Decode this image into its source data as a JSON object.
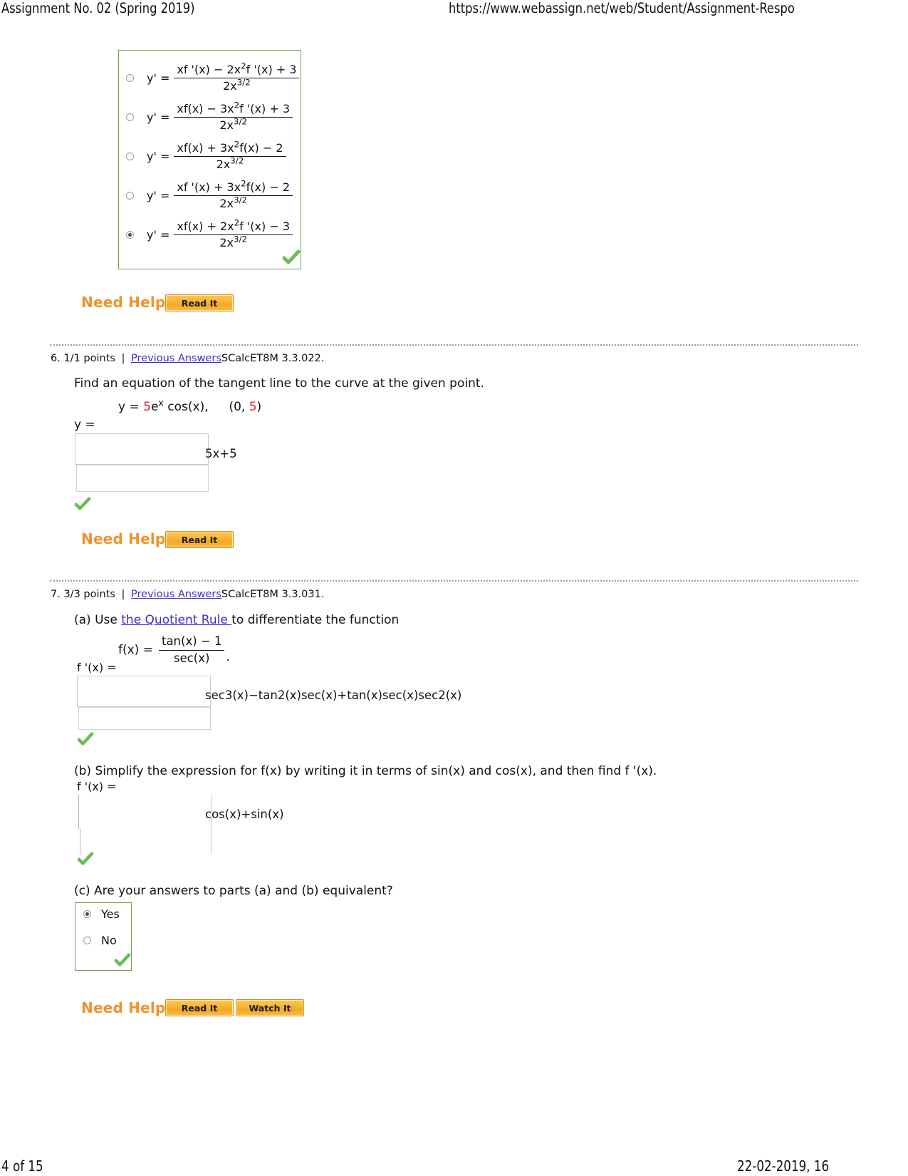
{
  "page": {
    "header_left": "Assignment No. 02 (Spring 2019)",
    "header_right": "https://www.webassign.net/web/Student/Assignment-Respo",
    "footer_left": "4 of 15",
    "footer_right": "22-02-2019, 16"
  },
  "question5": {
    "choices": [
      {
        "lhs": "y' =",
        "numerator": "xf '(x) − 2x 2f '(x) + 3",
        "denominator": "2x3/2",
        "selected": false
      },
      {
        "lhs": "y' =",
        "numerator": "xf(x) − 3x 2f '(x) + 3",
        "denominator": "2x3/2",
        "selected": false
      },
      {
        "lhs": "y' =",
        "numerator": "xf(x) + 3x 2f(x) − 2",
        "denominator": "2x3/2",
        "selected": false
      },
      {
        "lhs": "y' =",
        "numerator": "xf '(x) + 3x 2f(x) − 2",
        "denominator": "2x3/2",
        "selected": false
      },
      {
        "lhs": "y' =",
        "numerator": "xf(x) + 2x 2f '(x) − 3",
        "denominator": "2x3/2",
        "selected": true
      }
    ],
    "need_help_label": "Need Help?",
    "read_it_label": "Read It"
  },
  "question6": {
    "number": "6.",
    "points": "1/1 points",
    "separator": "|",
    "previous_answers": "Previous Answers",
    "problem_id": "SCalcET8M 3.3.022.",
    "prompt": "Find an equation of the tangent line to the curve at the given point.",
    "equation_lhs": "y =",
    "equation_coef": "5",
    "equation_rest": "cos(x),",
    "equation_exp_base": "e",
    "equation_exp": "x",
    "point_open": "(0,",
    "point_value": "5",
    "point_close": ")",
    "answer_label": "y =",
    "answer_value": "5x+5",
    "need_help_label": "Need Help?",
    "read_it_label": "Read It"
  },
  "question7": {
    "number": "7.",
    "points": "3/3 points",
    "separator": "|",
    "previous_answers": "Previous Answers",
    "problem_id": "SCalcET8M 3.3.031.",
    "part_a": {
      "text_before_link": "(a) Use ",
      "link_text": "the Quotient Rule ",
      "text_after_link": "to differentiate the function",
      "fn_lhs": "f(x) =",
      "fn_numerator": "tan(x) − 1",
      "fn_denominator": "sec(x)",
      "fn_period": ".",
      "answer_label": "f '(x) =",
      "answer_value": "sec3(x)−tan2(x)sec(x)+tan(x)sec(x)sec2(x)"
    },
    "part_b": {
      "prompt": "(b) Simplify the expression for   f(x)   by writing it in terms of sin(x) and cos(x), and then find    f '(x).",
      "answer_label": "f '(x) =",
      "answer_value": "cos(x)+sin(x)"
    },
    "part_c": {
      "prompt": "(c) Are your answers to parts (a) and (b) equivalent?",
      "options": [
        {
          "label": "Yes",
          "selected": true
        },
        {
          "label": "No",
          "selected": false
        }
      ]
    },
    "need_help_label": "Need Help?",
    "read_it_label": "Read It",
    "watch_it_label": "Watch It"
  },
  "colors": {
    "link": "#3b31c4",
    "accent_red": "#e8212a",
    "help_orange": "#f0922b",
    "check_green": "#6cbb5a",
    "box_green": "#6f9e57"
  }
}
